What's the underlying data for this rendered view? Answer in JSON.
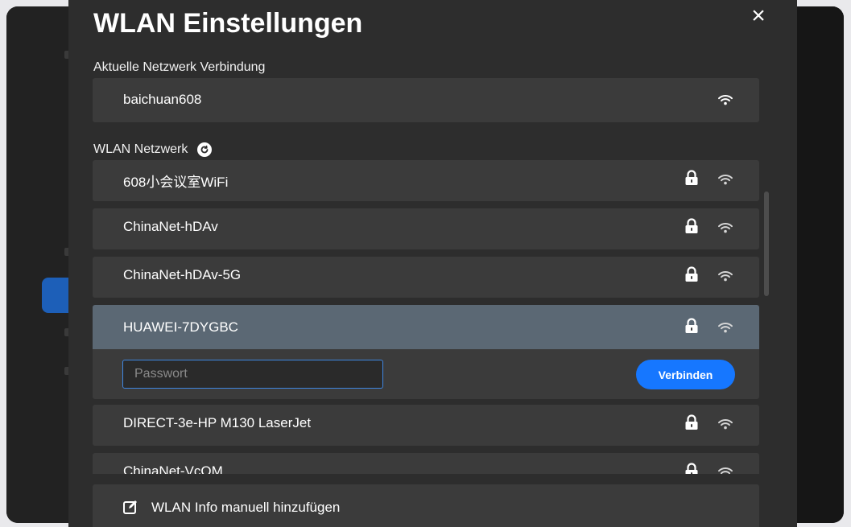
{
  "dialog": {
    "title": "WLAN Einstellungen",
    "close_icon": "close-icon"
  },
  "current_connection": {
    "label": "Aktuelle Netzwerk Verbindung",
    "ssid": "baichuan608",
    "icon": "wifi-icon"
  },
  "networks": {
    "label": "WLAN Netzwerk",
    "refresh_icon": "refresh-icon",
    "items": [
      {
        "ssid": "608小会议室WiFi",
        "locked": true,
        "selected": false
      },
      {
        "ssid": "ChinaNet-hDAv",
        "locked": true,
        "selected": false
      },
      {
        "ssid": "ChinaNet-hDAv-5G",
        "locked": true,
        "selected": false
      },
      {
        "ssid": "HUAWEI-7DYGBC",
        "locked": true,
        "selected": true
      },
      {
        "ssid": "DIRECT-3e-HP M130 LaserJet",
        "locked": true,
        "selected": false
      },
      {
        "ssid": "ChinaNet-VcQM",
        "locked": true,
        "selected": false
      }
    ]
  },
  "connect": {
    "password_placeholder": "Passwort",
    "password_value": "",
    "button_label": "Verbinden"
  },
  "manual_add": {
    "label": "WLAN Info manuell hinzufügen",
    "icon": "edit-icon"
  },
  "colors": {
    "dialog_bg": "#2d2d2d",
    "card_bg": "#3b3b3b",
    "selected_bg": "#5b6874",
    "accent": "#1677ff",
    "text": "#ffffff"
  }
}
